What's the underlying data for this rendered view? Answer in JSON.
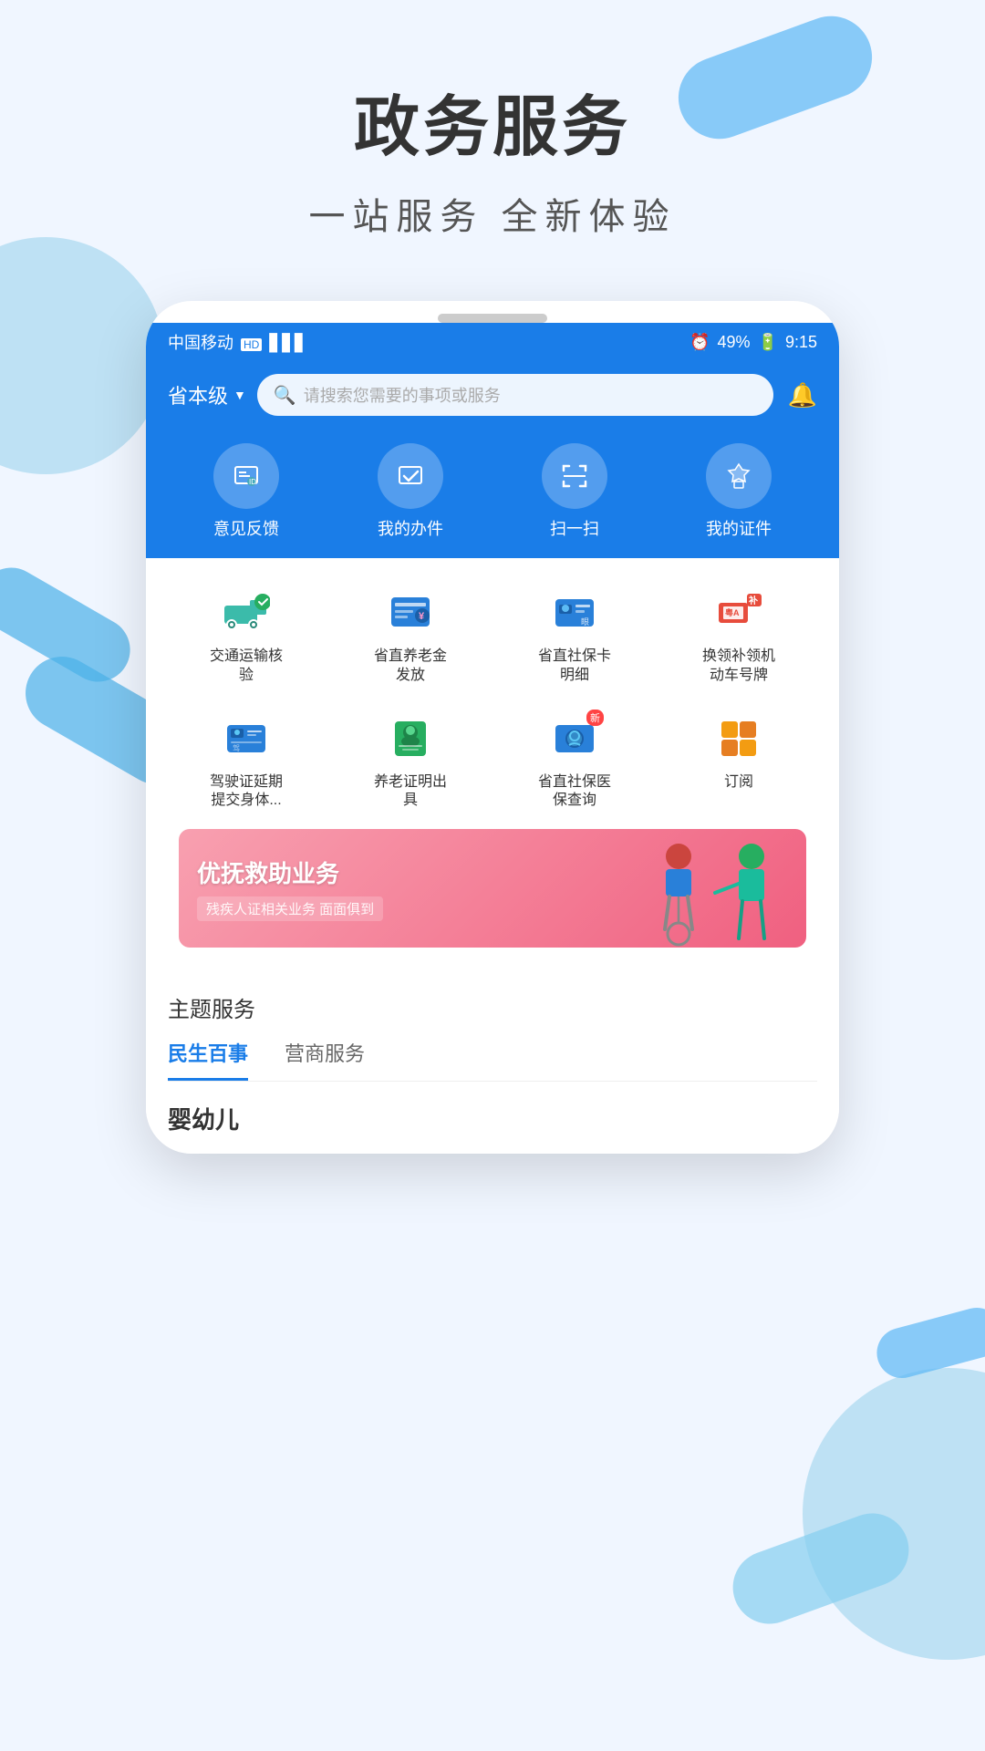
{
  "page": {
    "title": "政务服务",
    "subtitle": "一站服务   全新体验"
  },
  "status_bar": {
    "carrier": "中国移动",
    "hd": "HD",
    "signal": "4G",
    "battery": "49%",
    "time": "9:15"
  },
  "header": {
    "location": "省本级",
    "search_placeholder": "请搜索您需要的事项或服务"
  },
  "quick_actions": [
    {
      "id": "feedback",
      "label": "意见反馈",
      "icon": "🪪"
    },
    {
      "id": "office",
      "label": "我的办件",
      "icon": "✔"
    },
    {
      "id": "scan",
      "label": "扫一扫",
      "icon": "⊡"
    },
    {
      "id": "cert",
      "label": "我的证件",
      "icon": "◈"
    }
  ],
  "services": [
    {
      "id": "transport",
      "label": "交通运输核验",
      "icon": "🚚",
      "badge": null
    },
    {
      "id": "pension_pay",
      "label": "省直养老金发放",
      "icon": "📋",
      "badge": null
    },
    {
      "id": "social_detail",
      "label": "省直社保卡明细",
      "icon": "💳",
      "badge": null
    },
    {
      "id": "plate",
      "label": "换领补领机动车号牌",
      "icon": "🚗",
      "badge": "补"
    },
    {
      "id": "license",
      "label": "驾驶证延期提交身体...",
      "icon": "🪪",
      "badge": null
    },
    {
      "id": "cert_issue",
      "label": "养老证明出具",
      "icon": "👁",
      "badge": null
    },
    {
      "id": "medical",
      "label": "省直社保医保查询",
      "icon": "👁",
      "badge": "新"
    },
    {
      "id": "subscribe",
      "label": "订阅",
      "icon": "⊞",
      "badge": null
    }
  ],
  "banner": {
    "title": "优抚救助业务",
    "subtitle": "残疾人证相关业务  面面俱到"
  },
  "theme_section": {
    "title": "主题服务",
    "tabs": [
      {
        "id": "livelihood",
        "label": "民生百事",
        "active": true
      },
      {
        "id": "business",
        "label": "营商服务",
        "active": false
      }
    ]
  },
  "category": {
    "title": "婴幼儿"
  }
}
